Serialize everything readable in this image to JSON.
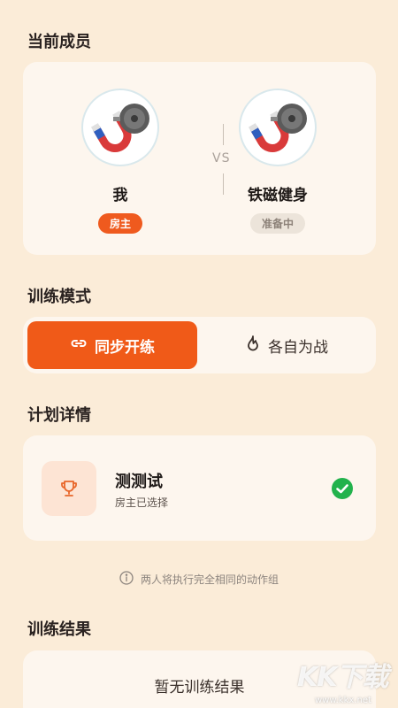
{
  "members_section": {
    "title": "当前成员",
    "left": {
      "name": "我",
      "tag": "房主"
    },
    "right": {
      "name": "铁磁健身",
      "tag": "准备中"
    },
    "vs": "VS",
    "avatar_icon": "magnet-dumbbell-icon"
  },
  "mode_section": {
    "title": "训练模式",
    "sync": {
      "label": "同步开练",
      "icon": "link-icon",
      "active": true
    },
    "solo": {
      "label": "各自为战",
      "icon": "flame-icon",
      "active": false
    }
  },
  "plan_section": {
    "title": "计划详情",
    "name": "测测试",
    "sub": "房主已选择",
    "icon": "trophy-icon",
    "status_icon": "check-circle-icon",
    "hint": "两人将执行完全相同的动作组"
  },
  "result_section": {
    "title": "训练结果",
    "empty_text": "暂无训练结果"
  },
  "watermark": {
    "logo": "KK下载",
    "url": "www.kkx.net"
  },
  "colors": {
    "accent": "#f05a18",
    "background": "#fbecd8",
    "card": "#fdf6ee",
    "success": "#22b24c"
  }
}
